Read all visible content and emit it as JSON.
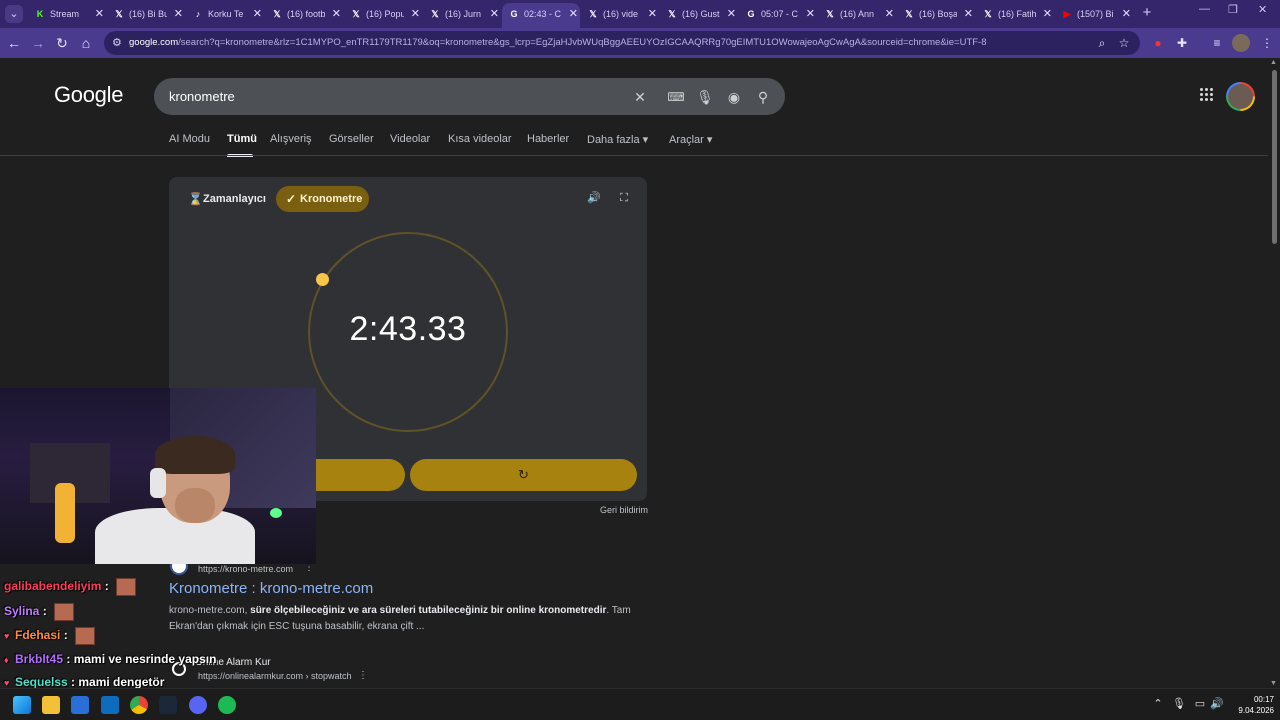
{
  "browser": {
    "tabs": [
      {
        "label": "Stream",
        "icon": "kick-icon",
        "icon_char": "K",
        "color": "#53fc18",
        "active": false
      },
      {
        "label": "(16) Bi Bu",
        "icon": "x-icon",
        "icon_char": "𝕏",
        "color": "#ffffff",
        "active": false
      },
      {
        "label": "Korku Te",
        "icon": "tiktok-icon",
        "icon_char": "♪",
        "color": "#ffffff",
        "active": false
      },
      {
        "label": "(16) footb",
        "icon": "x-icon",
        "icon_char": "𝕏",
        "color": "#ffffff",
        "active": false
      },
      {
        "label": "(16) Popu",
        "icon": "x-icon",
        "icon_char": "𝕏",
        "color": "#ffffff",
        "active": false
      },
      {
        "label": "(16) Jurn",
        "icon": "x-icon",
        "icon_char": "𝕏",
        "color": "#ffffff",
        "active": false
      },
      {
        "label": "02:43 - C",
        "icon": "google-icon",
        "icon_char": "G",
        "color": "#ffffff",
        "active": true
      },
      {
        "label": "(16) vide",
        "icon": "x-icon",
        "icon_char": "𝕏",
        "color": "#ffffff",
        "active": false
      },
      {
        "label": "(16) Gust",
        "icon": "x-icon",
        "icon_char": "𝕏",
        "color": "#ffffff",
        "active": false
      },
      {
        "label": "05:07 - C",
        "icon": "google-icon",
        "icon_char": "G",
        "color": "#ffffff",
        "active": false
      },
      {
        "label": "(16) Ann",
        "icon": "x-icon",
        "icon_char": "𝕏",
        "color": "#ffffff",
        "active": false
      },
      {
        "label": "(16) Boşa",
        "icon": "x-icon",
        "icon_char": "𝕏",
        "color": "#ffffff",
        "active": false
      },
      {
        "label": "(16) Fatih",
        "icon": "x-icon",
        "icon_char": "𝕏",
        "color": "#ffffff",
        "active": false
      },
      {
        "label": "(1507) Bi",
        "icon": "youtube-icon",
        "icon_char": "▶",
        "color": "#ff0000",
        "active": false
      }
    ],
    "url_host": "google.com",
    "url_rest": "/search?q=kronometre&rlz=1C1MYPO_enTR1179TR1179&oq=kronometre&gs_lcrp=EgZjaHJvbWUqBggAEEUYOzIGCAAQRRg70gEIMTU1OWowajeoAgCwAgA&sourceid=chrome&ie=UTF-8"
  },
  "google": {
    "logo": "Google",
    "query": "kronometre",
    "nav_tabs": [
      "AI Modu",
      "Tümü",
      "Alışveriş",
      "Görseller",
      "Videolar",
      "Kısa videolar",
      "Haberler",
      "Daha fazla ▾",
      "Araçlar ▾"
    ],
    "active_tab": "Tümü"
  },
  "stopwatch": {
    "timer_tab": "Zamanlayıcı",
    "stopwatch_tab": "Kronometre",
    "time": "2:43.33",
    "reset_symbol": "↻",
    "feedback": "Geri bildirim",
    "accent": "#a8820e"
  },
  "results": [
    {
      "site_url": "https://krono-metre.com",
      "title": "Kronometre : krono-metre.com",
      "snippet_pre": "krono-metre.com, ",
      "snippet_bold": "süre ölçebileceğiniz ve ara süreleri tutabileceğiniz bir online kronometredir",
      "snippet_post": ". Tam Ekran'dan çıkmak için ESC tuşuna basabilir, ekrana çift ..."
    },
    {
      "site_name": "Online Alarm Kur",
      "site_url": "https://onlinealarmkur.com › stopwatch"
    }
  ],
  "chat": [
    {
      "user": "galibabendeliyim",
      "color": "#ff3b5c",
      "message": ""
    },
    {
      "user": "Sylina",
      "color": "#c07cff",
      "message": ""
    },
    {
      "user": "Fdehasi",
      "color": "#ff8a3d",
      "message": ""
    },
    {
      "user": "Brkblt45",
      "color": "#b46bff",
      "message": "mami ve nesrinde yapsın"
    },
    {
      "user": "Sequelss",
      "color": "#4fe0c8",
      "message": "mami dengetör"
    }
  ],
  "taskbar": {
    "time": "00:17",
    "date": "9.04.2026"
  }
}
